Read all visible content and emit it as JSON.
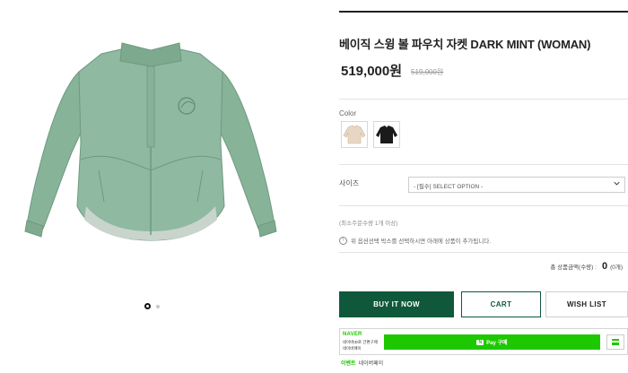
{
  "product": {
    "title": "베이직 스윙 볼 파우치 자켓 DARK MINT (WOMAN)",
    "price": "519,000원",
    "original_price": "519,000원",
    "main_image": "dark mint women's jacket"
  },
  "gallery": {
    "slides": [
      {
        "state": "active"
      },
      {
        "state": "inactive"
      }
    ]
  },
  "color": {
    "label": "Color",
    "options": [
      {
        "name": "beige jacket swatch",
        "color": "#e8d6c4"
      },
      {
        "name": "black jacket swatch",
        "color": "#1a1a1a"
      }
    ]
  },
  "size": {
    "label": "사이즈",
    "placeholder": "- [필수] SELECT OPTION -"
  },
  "min_qty_text": "(최소주문수량 1개 이상)",
  "notice_text": "위 옵션선택 박스를 선택하시면 아래에 상품이 추가됩니다.",
  "total": {
    "label": "총 상품금액(수량) :",
    "value": "0",
    "unit": "(0개)"
  },
  "buttons": {
    "buy": "BUY IT NOW",
    "cart": "CART",
    "wish": "WISH LIST"
  },
  "naver": {
    "brand": "NAVER",
    "line1": "네이버ID로 간편구매",
    "line2": "네이버페이",
    "pay_badge": "N",
    "pay_label": "Pay 구매"
  },
  "footer": {
    "link1": "이벤트",
    "link2": "네이버페이"
  },
  "colors": {
    "brand_green": "#10583c",
    "naver_green": "#1ec800",
    "jacket_mint": "#8fb9a0"
  }
}
